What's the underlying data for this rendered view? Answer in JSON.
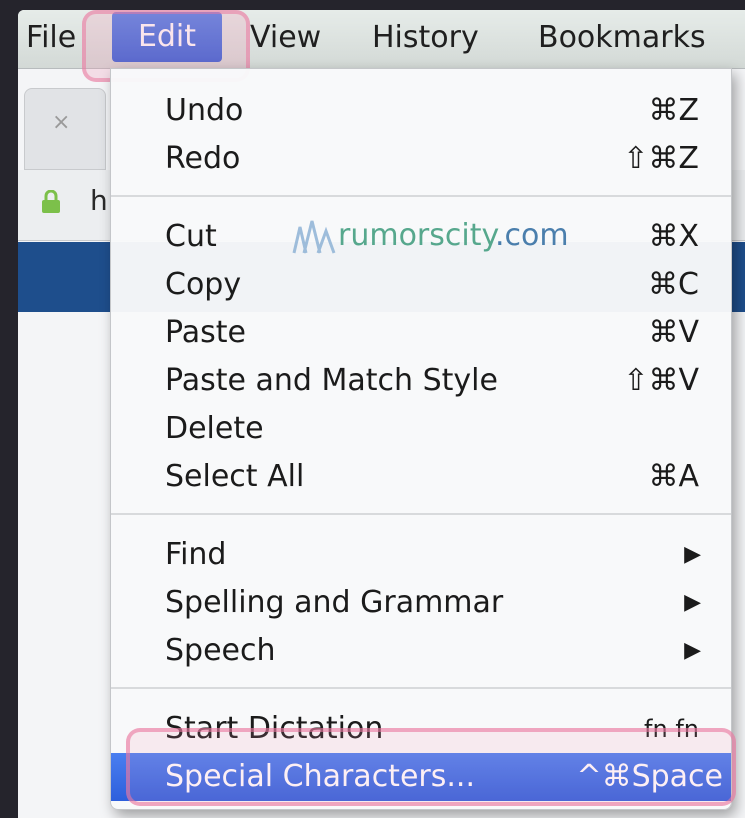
{
  "menubar": {
    "file": "File",
    "edit": "Edit",
    "view": "View",
    "history": "History",
    "bookmarks": "Bookmarks"
  },
  "browser": {
    "tab_close": "×",
    "url_fragment": "h"
  },
  "watermark": {
    "name": "rumorscity",
    "tld": ".com"
  },
  "menu": {
    "items": [
      {
        "label": "Undo",
        "shortcut": "⌘Z"
      },
      {
        "label": "Redo",
        "shortcut": "⇧⌘Z"
      },
      {
        "label": "Cut",
        "shortcut": "⌘X"
      },
      {
        "label": "Copy",
        "shortcut": "⌘C"
      },
      {
        "label": "Paste",
        "shortcut": "⌘V"
      },
      {
        "label": "Paste and Match Style",
        "shortcut": "⇧⌘V"
      },
      {
        "label": "Delete",
        "shortcut": ""
      },
      {
        "label": "Select All",
        "shortcut": "⌘A"
      },
      {
        "label": "Find",
        "submenu": "▶"
      },
      {
        "label": "Spelling and Grammar",
        "submenu": "▶"
      },
      {
        "label": "Speech",
        "submenu": "▶"
      },
      {
        "label": "Start Dictation",
        "shortcut": "fn fn"
      },
      {
        "label": "Special Characters...",
        "shortcut": "^⌘Space"
      }
    ]
  },
  "colors": {
    "selection": "#2d5fdc",
    "highlight_ring": "#e978a0"
  }
}
